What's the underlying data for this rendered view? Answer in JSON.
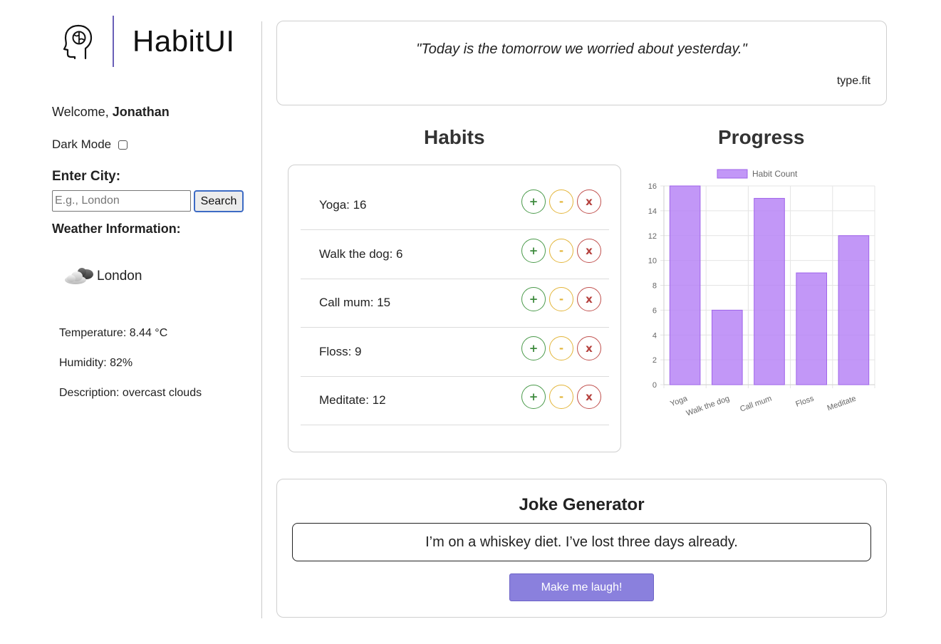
{
  "app": {
    "name": "HabitUI",
    "accent": "#6a5fb8",
    "logo_icon": "head-brain-icon"
  },
  "sidebar": {
    "welcome_prefix": "Welcome, ",
    "username": "Jonathan",
    "dark_mode_label": "Dark Mode",
    "dark_mode_checked": false,
    "city_label": "Enter City:",
    "city_placeholder": "E.g., London",
    "city_value": "",
    "search_label": "Search",
    "weather_title": "Weather Information:",
    "weather": {
      "icon": "cloud-icon",
      "city": "London",
      "temperature": "Temperature: 8.44 °C",
      "humidity": "Humidity: 82%",
      "description": "Description: overcast clouds"
    }
  },
  "quote": {
    "text": "\"Today is the tomorrow we worried about yesterday.\"",
    "author": "type.fit"
  },
  "habits": {
    "title": "Habits",
    "items": [
      {
        "label": "Yoga: 16"
      },
      {
        "label": "Walk the dog: 6"
      },
      {
        "label": "Call mum: 15"
      },
      {
        "label": "Floss: 9"
      },
      {
        "label": "Meditate: 12"
      }
    ],
    "buttons": {
      "plus": "+",
      "minus": "-",
      "delete": "x"
    },
    "colors": {
      "plus": "#4a9a4a",
      "minus": "#e3b53a",
      "delete": "#c0504d"
    }
  },
  "progress": {
    "title": "Progress"
  },
  "chart_data": {
    "type": "bar",
    "categories": [
      "Yoga",
      "Walk the dog",
      "Call mum",
      "Floss",
      "Meditate"
    ],
    "series": [
      {
        "name": "Habit Count",
        "values": [
          16,
          6,
          15,
          9,
          12
        ],
        "color": "#b580f5"
      }
    ],
    "ylim": [
      0,
      16
    ],
    "yticks": [
      0,
      2,
      4,
      6,
      8,
      10,
      12,
      14,
      16
    ],
    "grid": true,
    "legend": "top-center"
  },
  "joke": {
    "title": "Joke Generator",
    "text": "I’m on a whiskey diet. I’ve lost three days already.",
    "button_label": "Make me laugh!",
    "button_color": "#8a80dd"
  }
}
